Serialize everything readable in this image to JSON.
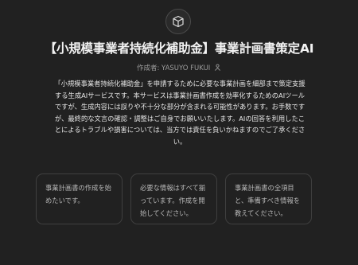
{
  "gpt": {
    "icon": "cube-icon",
    "title": "【小規模事業者持続化補助金】事業計画書策定AI",
    "author_prefix": "作成者: ",
    "author_name": "YASUYO FUKUI",
    "author_icon": "person-icon",
    "description": "「小規模事業者持続化補助金」を申請するために必要な事業計画を細部まで策定支援する生成AIサービスです。本サービスは事業計画書作成を効率化するためのAIツールですが、生成内容には誤りや不十分な部分が含まれる可能性があります。お手数ですが、最終的な文言の確認・調整はご自身でお願いいたします。AIの回答を利用したことによるトラブルや損害については、当方では責任を負いかねますのでご了承ください。"
  },
  "conversation_starters": [
    {
      "label": "事業計画書の作成を始めたいです。"
    },
    {
      "label": "必要な情報はすべて揃っています。作成を開始してください。"
    },
    {
      "label": "事業計画書の全項目と、準備すべき情報を教えてください。"
    }
  ],
  "colors": {
    "background": "#212121",
    "text_primary": "#ececec",
    "text_muted": "#9b9b9b",
    "card_border": "#3f3f3f"
  }
}
